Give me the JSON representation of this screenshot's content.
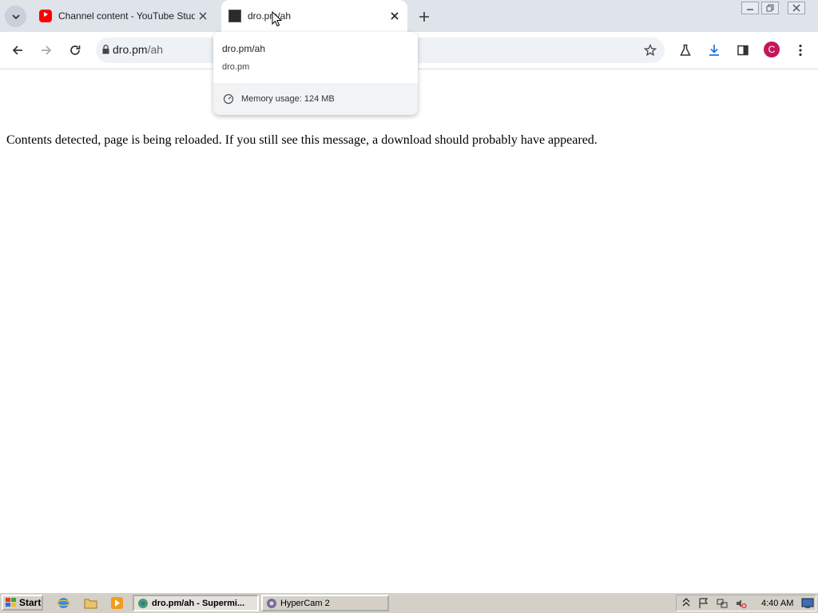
{
  "tabs": [
    {
      "title": "Channel content - YouTube Studio",
      "favicon": "youtube-icon",
      "active": false
    },
    {
      "title": "dro.pm/ah",
      "favicon": "dro-pm-icon",
      "active": true
    }
  ],
  "toolbar": {
    "url_host": "dro.pm",
    "url_path": "/ah",
    "profile_initial": "C"
  },
  "hovercard": {
    "title": "dro.pm/ah",
    "domain": "dro.pm",
    "memory": "Memory usage: 124 MB"
  },
  "page": {
    "message": "Contents detected, page is being reloaded. If you still see this message, a download should probably have appeared."
  },
  "taskbar": {
    "start_label": "Start",
    "tasks": [
      {
        "label": "dro.pm/ah - Supermi...",
        "active": true
      },
      {
        "label": "HyperCam 2",
        "active": false
      }
    ],
    "clock": "4:40 AM"
  },
  "colors": {
    "tabstrip_bg": "#dfe3ea",
    "omnibox_bg": "#eef1f6",
    "avatar_bg": "#c2185b",
    "taskbar_bg": "#d4d0c8"
  }
}
